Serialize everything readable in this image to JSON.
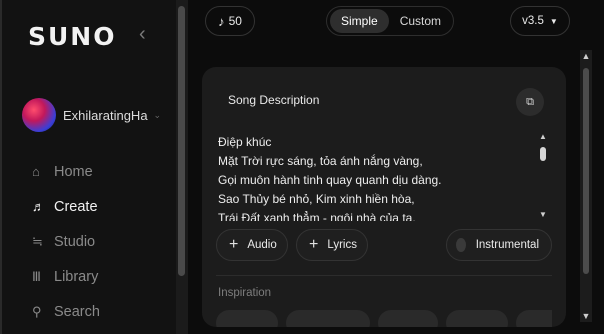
{
  "sidebar": {
    "logo": "SUNO",
    "collapse_icon": "‹",
    "username": "ExhilaratingHa",
    "nav": [
      {
        "label": "Home",
        "icon": "home-icon",
        "glyph": "⌂",
        "active": false
      },
      {
        "label": "Create",
        "icon": "music-note-icon",
        "glyph": "♬",
        "active": true
      },
      {
        "label": "Studio",
        "icon": "studio-icon",
        "glyph": "≒",
        "active": false
      },
      {
        "label": "Library",
        "icon": "library-icon",
        "glyph": "Ⅲ",
        "active": false
      },
      {
        "label": "Search",
        "icon": "search-icon",
        "glyph": "⚲",
        "active": false
      }
    ]
  },
  "topbar": {
    "credits": "50",
    "mode_simple": "Simple",
    "mode_custom": "Custom",
    "selected_mode": "Simple",
    "version": "v3.5"
  },
  "card": {
    "title": "Song Description",
    "description_lines": [
      "Điệp khúc",
      "Mặt Trời rực sáng, tỏa ánh nắng vàng,",
      "Gọi muôn hành tinh quay quanh dịu dàng.",
      "Sao Thủy bé nhỏ, Kim xinh hiền hòa,",
      "Trái Đất xanh thẳm - ngôi nhà của ta."
    ],
    "audio_label": "Audio",
    "lyrics_label": "Lyrics",
    "instrumental_label": "Instrumental",
    "instrumental_on": false,
    "inspiration_label": "Inspiration"
  },
  "colors": {
    "background": "#0c0c0c",
    "sidebar": "#121212",
    "card": "#1c1c1c",
    "chip_border": "#333333",
    "active_text": "#f2f2f2",
    "inactive_text": "#8a8a8a"
  }
}
